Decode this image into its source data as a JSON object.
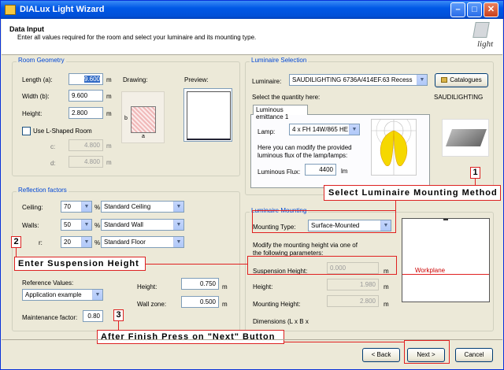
{
  "window": {
    "title": "DIALux Light Wizard"
  },
  "header": {
    "title": "Data Input",
    "subtitle": "Enter all values required for the room and select your luminaire and its mounting type."
  },
  "logo": {
    "text": "light"
  },
  "room_geometry": {
    "label": "Room Geometry",
    "length_label": "Length (a):",
    "length_value": "9.600",
    "length_unit": "m",
    "width_label": "Width (b):",
    "width_value": "9.600",
    "width_unit": "m",
    "height_label": "Height:",
    "height_value": "2.800",
    "height_unit": "m",
    "lshape_label": "Use L-Shaped Room",
    "c_label": "c:",
    "c_value": "4.800",
    "c_unit": "m",
    "d_label": "d:",
    "d_value": "4.800",
    "d_unit": "m",
    "drawing_label": "Drawing:",
    "preview_label": "Preview:",
    "drawing_a": "a",
    "drawing_b": "b"
  },
  "reflection": {
    "label": "Reflection factors",
    "ceiling_label": "Ceiling:",
    "ceiling_value": "70",
    "ceiling_type": "Standard Ceiling",
    "walls_label": "Walls:",
    "walls_value": "50",
    "walls_type": "Standard Wall",
    "floor_label": "r:",
    "floor_value": "20",
    "floor_type": "Standard Floor",
    "percent": "%",
    "reference_label": "Reference Values:",
    "reference_value": "Application example",
    "maintenance_label": "Maintenance factor:",
    "maintenance_value": "0.80"
  },
  "workplane_fields": {
    "height_label": "Height:",
    "height_value": "0.750",
    "height_unit": "m",
    "wallzone_label": "Wall zone:",
    "wallzone_value": "0.500",
    "wallzone_unit": "m"
  },
  "luminaire": {
    "label": "Luminaire Selection",
    "luminaire_label": "Luminaire:",
    "luminaire_value": "SAUDILIGHTING 6736A/414EF.63 Recess",
    "catalogues_button": "Catalogues",
    "quantity_label": "Select the quantity here:",
    "manufacturer": "SAUDILIGHTING",
    "tab_label": "Luminous emittance 1",
    "lamp_label": "Lamp:",
    "lamp_value": "4 x FH 14W/865 HE",
    "info_text_1": "Here you can modify the provided",
    "info_text_2": "luminous flux of the lamp/lamps:",
    "flux_label": "Luminous Flux:",
    "flux_value": "4400",
    "flux_unit": "lm"
  },
  "mounting": {
    "label": "Luminaire Mounting",
    "type_label": "Mounting Type:",
    "type_value": "Surface-Mounted",
    "modify_text_1": "Modify the mounting height via one of",
    "modify_text_2": "the following parameters:",
    "suspension_label": "Suspension Height:",
    "suspension_value": "0.000",
    "suspension_unit": "m",
    "height_label": "Height:",
    "height_value": "1.980",
    "height_unit": "m",
    "mheight_label": "Mounting Height:",
    "mheight_value": "2.800",
    "mheight_unit": "m",
    "dimensions_label": "Dimensions (L x B x",
    "workplane_label": "Workplane"
  },
  "annotations": {
    "callout_1": "Select  Luminaire  Mounting  Method",
    "callout_2": "Enter  Suspension  Height",
    "callout_3": "After  Finish  Press  on  \"Next\"  Button",
    "num_1": "1",
    "num_2": "2",
    "num_3": "3"
  },
  "footer": {
    "back": "< Back",
    "next": "Next >",
    "cancel": "Cancel"
  },
  "colors": {
    "titlebar": "#0058e6",
    "group_label": "#0046d5",
    "annotation": "#e02020"
  }
}
